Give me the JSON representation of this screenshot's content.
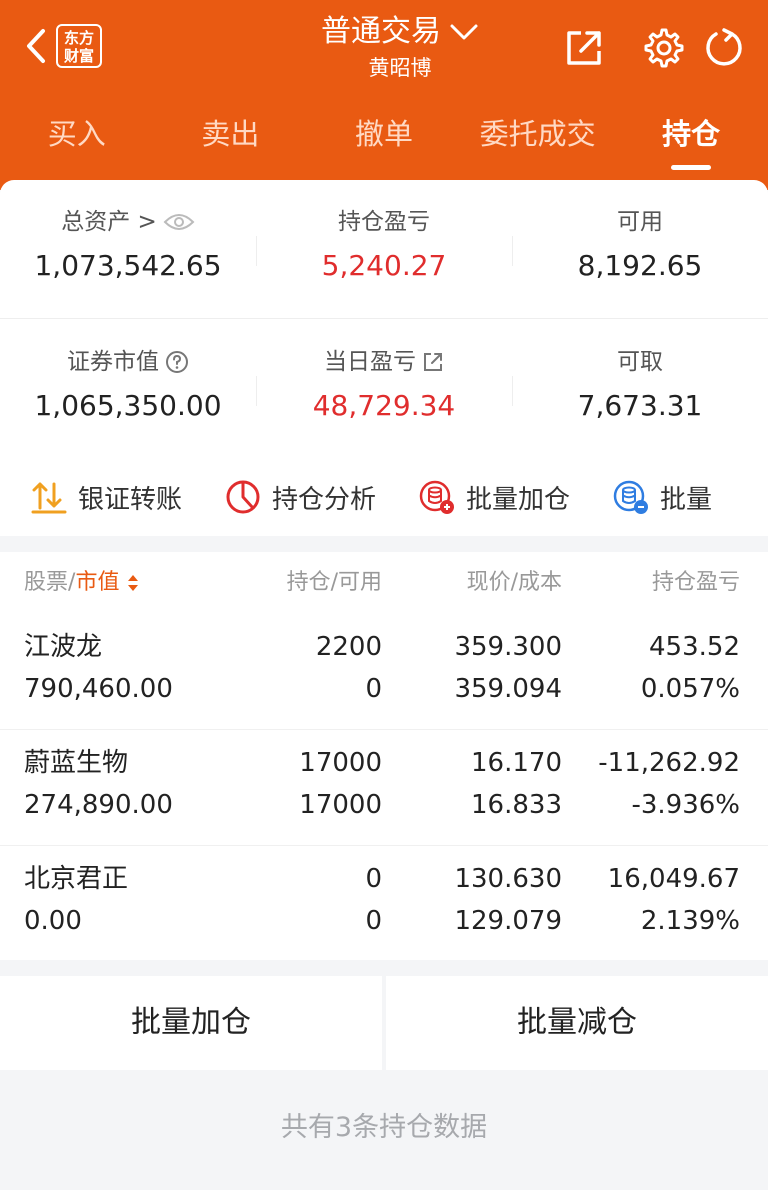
{
  "header": {
    "logo_text": "东方\n财富",
    "title": "普通交易",
    "subtitle": "黄昭博",
    "brand_color": "#e95a12"
  },
  "tabs": [
    {
      "label": "买入"
    },
    {
      "label": "卖出"
    },
    {
      "label": "撤单"
    },
    {
      "label": "委托成交"
    },
    {
      "label": "持仓",
      "active": true
    }
  ],
  "assets": {
    "row1": [
      {
        "label": "总资产 >",
        "value": "1,073,542.65"
      },
      {
        "label": "持仓盈亏",
        "value": "5,240.27"
      },
      {
        "label": "可用",
        "value": "8,192.65"
      }
    ],
    "row2": [
      {
        "label": "证券市值",
        "value": "1,065,350.00"
      },
      {
        "label": "当日盈亏",
        "value": "48,729.34"
      },
      {
        "label": "可取",
        "value": "7,673.31"
      }
    ]
  },
  "quick_actions": [
    {
      "label": "银证转账",
      "icon": "transfer-icon"
    },
    {
      "label": "持仓分析",
      "icon": "pie-chart-icon"
    },
    {
      "label": "批量加仓",
      "icon": "batch-add-icon"
    },
    {
      "label": "批量",
      "icon": "batch-icon"
    }
  ],
  "table": {
    "headers": {
      "stock": "股票",
      "sep": "/",
      "market_value": "市值",
      "position": "持仓/可用",
      "price": "现价/成本",
      "pnl": "持仓盈亏"
    },
    "rows": [
      {
        "name": "江波龙",
        "market_value": "790,460.00",
        "position": "2200",
        "available": "0",
        "price": "359.300",
        "cost": "359.094",
        "pnl": "453.52",
        "pnl_pct": "0.057%",
        "trend": "up"
      },
      {
        "name": "蔚蓝生物",
        "market_value": "274,890.00",
        "position": "17000",
        "available": "17000",
        "price": "16.170",
        "cost": "16.833",
        "pnl": "-11,262.92",
        "pnl_pct": "-3.936%",
        "trend": "down"
      },
      {
        "name": "北京君正",
        "market_value": "0.00",
        "position": "0",
        "available": "0",
        "price": "130.630",
        "cost": "129.079",
        "pnl": "16,049.67",
        "pnl_pct": "2.139%",
        "trend": "up"
      }
    ]
  },
  "bottom": {
    "batch_add": "批量加仓",
    "batch_reduce": "批量减仓",
    "note": "共有3条持仓数据"
  }
}
